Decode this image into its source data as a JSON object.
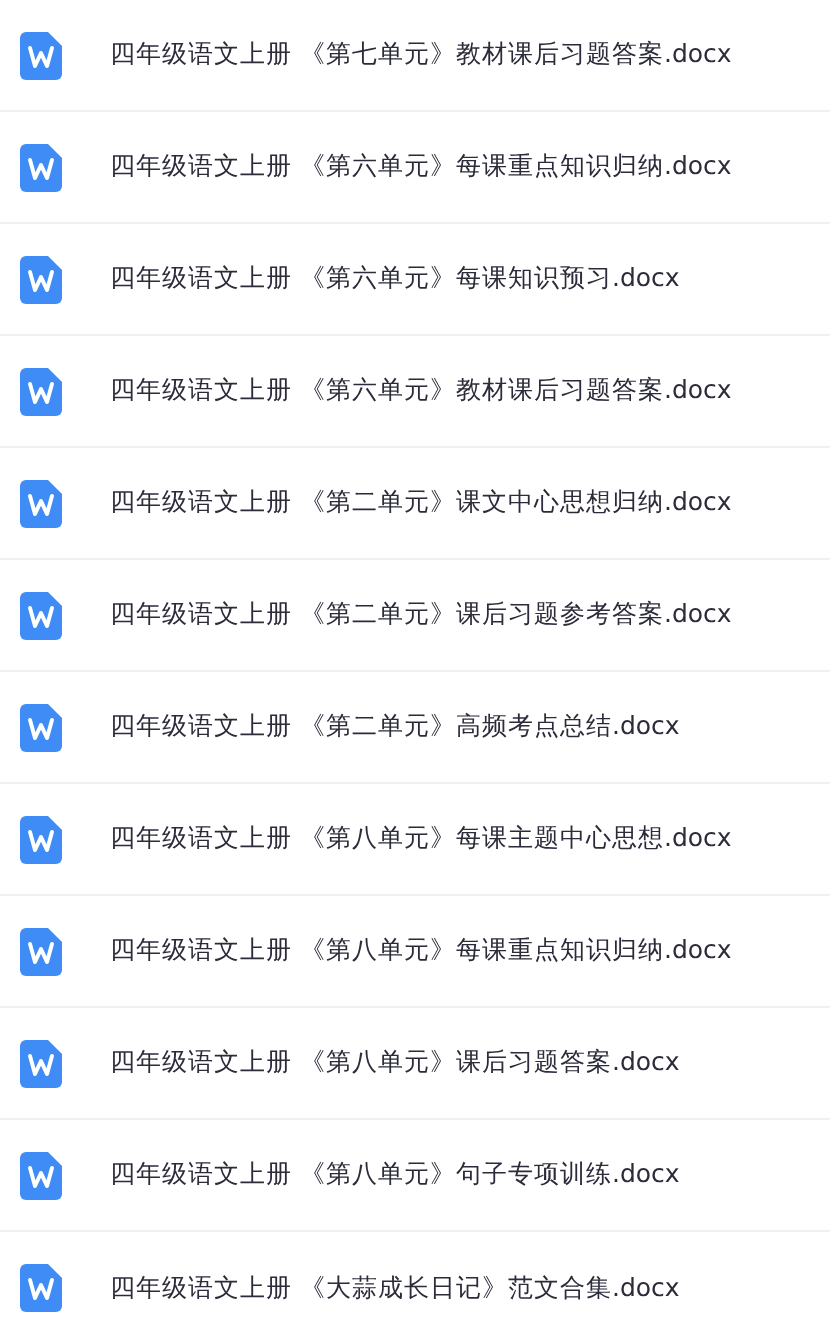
{
  "files": [
    {
      "name": "四年级语文上册 《第七单元》教材课后习题答案.docx"
    },
    {
      "name": "四年级语文上册 《第六单元》每课重点知识归纳.docx"
    },
    {
      "name": "四年级语文上册 《第六单元》每课知识预习.docx"
    },
    {
      "name": "四年级语文上册 《第六单元》教材课后习题答案.docx"
    },
    {
      "name": "四年级语文上册 《第二单元》课文中心思想归纳.docx"
    },
    {
      "name": "四年级语文上册 《第二单元》课后习题参考答案.docx"
    },
    {
      "name": "四年级语文上册 《第二单元》高频考点总结.docx"
    },
    {
      "name": "四年级语文上册 《第八单元》每课主题中心思想.docx"
    },
    {
      "name": "四年级语文上册 《第八单元》每课重点知识归纳.docx"
    },
    {
      "name": "四年级语文上册 《第八单元》课后习题答案.docx"
    },
    {
      "name": "四年级语文上册 《第八单元》句子专项训练.docx"
    },
    {
      "name": "四年级语文上册 《大蒜成长日记》范文合集.docx"
    }
  ]
}
